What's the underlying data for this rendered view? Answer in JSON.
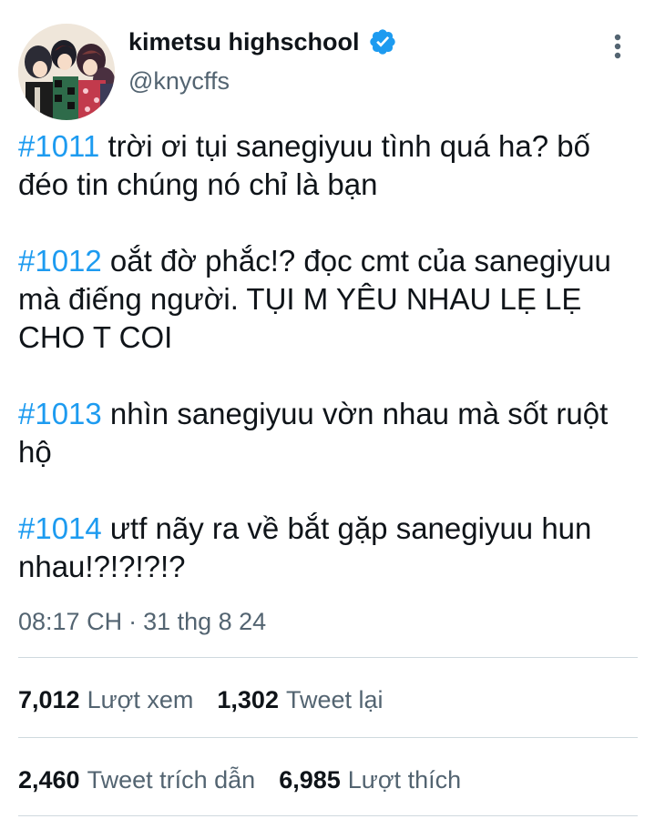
{
  "author": {
    "display_name": "kimetsu highschool",
    "handle": "@knycffs",
    "avatar_icon": "anime-group-avatar",
    "verified_icon": "verified-badge-icon"
  },
  "colors": {
    "link": "#1d9bf0",
    "text": "#0f1419",
    "secondary": "#536471",
    "divider": "#cfd9de"
  },
  "tweet": {
    "paragraphs": [
      {
        "hashtag": "#1011",
        "text": " trời ơi tụi sanegiyuu tình quá ha? bố đéo tin chúng nó chỉ là bạn"
      },
      {
        "hashtag": "#1012",
        "text": " oắt đờ phắc!? đọc cmt của sanegiyuu mà điếng người. TỤI M YÊU NHAU LẸ LẸ CHO T COI"
      },
      {
        "hashtag": "#1013",
        "text": " nhìn sanegiyuu vờn nhau mà sốt ruột hộ"
      },
      {
        "hashtag": "#1014",
        "text": " ưtf nãy ra về bắt gặp sanegiyuu hun nhau!?!?!?!?"
      }
    ]
  },
  "meta": {
    "time": "08:17 CH",
    "separator": "·",
    "date": "31 thg 8 24"
  },
  "stats": {
    "views_value": "7,012",
    "views_label": "Lượt xem",
    "retweets_value": "1,302",
    "retweets_label": "Tweet lại",
    "quotes_value": "2,460",
    "quotes_label": "Tweet trích dẫn",
    "likes_value": "6,985",
    "likes_label": "Lượt thích"
  }
}
